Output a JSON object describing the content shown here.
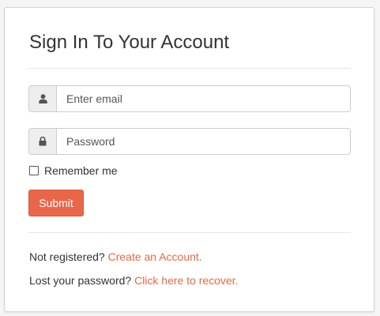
{
  "form": {
    "title": "Sign In To Your Account",
    "email": {
      "icon": "user-icon",
      "placeholder": "Enter email",
      "value": ""
    },
    "password": {
      "icon": "lock-icon",
      "placeholder": "Password",
      "value": ""
    },
    "remember_label": "Remember me",
    "remember_checked": false,
    "submit_label": "Submit"
  },
  "footer": {
    "register_prompt": "Not registered?",
    "register_link": "Create an Account.",
    "recover_prompt": "Lost your password?",
    "recover_link": "Click here to recover."
  },
  "colors": {
    "accent": "#e8674a",
    "addon_bg": "#eeeeee",
    "border": "#cccccc"
  }
}
